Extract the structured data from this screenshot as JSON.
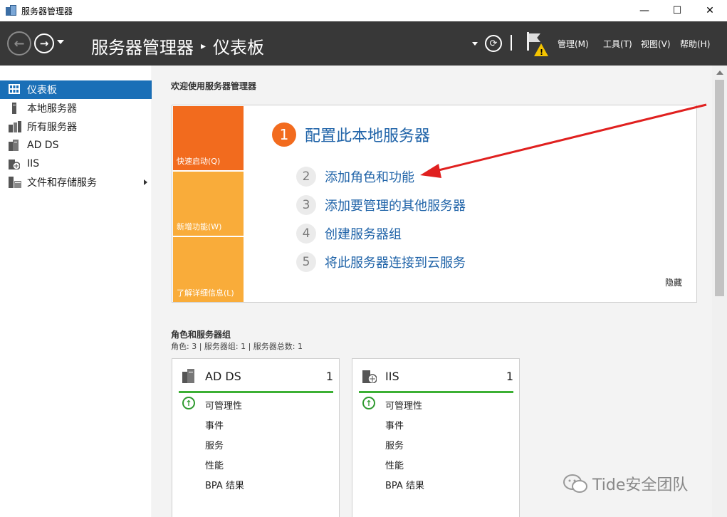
{
  "window": {
    "title": "服务器管理器",
    "controls": {
      "minimize": "—",
      "maximize": "☐",
      "close": "✕"
    }
  },
  "header": {
    "breadcrumb_root": "服务器管理器",
    "breadcrumb_sep": "▸",
    "breadcrumb_current": "仪表板",
    "menus": {
      "manage": "管理(M)",
      "tools": "工具(T)",
      "view": "视图(V)",
      "help": "帮助(H)"
    }
  },
  "sidebar": {
    "items": [
      {
        "label": "仪表板",
        "icon": "dashboard-icon",
        "active": true
      },
      {
        "label": "本地服务器",
        "icon": "local-server-icon"
      },
      {
        "label": "所有服务器",
        "icon": "all-servers-icon"
      },
      {
        "label": "AD DS",
        "icon": "ad-ds-icon"
      },
      {
        "label": "IIS",
        "icon": "iis-icon"
      },
      {
        "label": "文件和存储服务",
        "icon": "file-storage-icon",
        "expandable": true
      }
    ]
  },
  "welcome": {
    "title": "欢迎使用服务器管理器",
    "tiles": {
      "quick_start": "快速启动(Q)",
      "whats_new": "新增功能(W)",
      "learn_more": "了解详细信息(L)"
    },
    "steps": [
      {
        "number": "1",
        "label": "配置此本地服务器"
      },
      {
        "number": "2",
        "label": "添加角色和功能"
      },
      {
        "number": "3",
        "label": "添加要管理的其他服务器"
      },
      {
        "number": "4",
        "label": "创建服务器组"
      },
      {
        "number": "5",
        "label": "将此服务器连接到云服务"
      }
    ],
    "hide": "隐藏"
  },
  "roles": {
    "title": "角色和服务器组",
    "summary": "角色: 3 | 服务器组: 1 | 服务器总数: 1",
    "cards": [
      {
        "name": "AD DS",
        "count": "1",
        "rows": [
          "可管理性",
          "事件",
          "服务",
          "性能",
          "BPA 结果"
        ]
      },
      {
        "name": "IIS",
        "count": "1",
        "rows": [
          "可管理性",
          "事件",
          "服务",
          "性能",
          "BPA 结果"
        ]
      }
    ]
  },
  "watermark": {
    "text": "Tide安全团队"
  },
  "colors": {
    "header_bg": "#383838",
    "accent": "#1a6fb7",
    "orange": "#f26b1e",
    "tile_amber": "#f9ac3a",
    "link": "#1f63a8",
    "status_green": "#3cb034",
    "arrow": "#e0201f"
  }
}
